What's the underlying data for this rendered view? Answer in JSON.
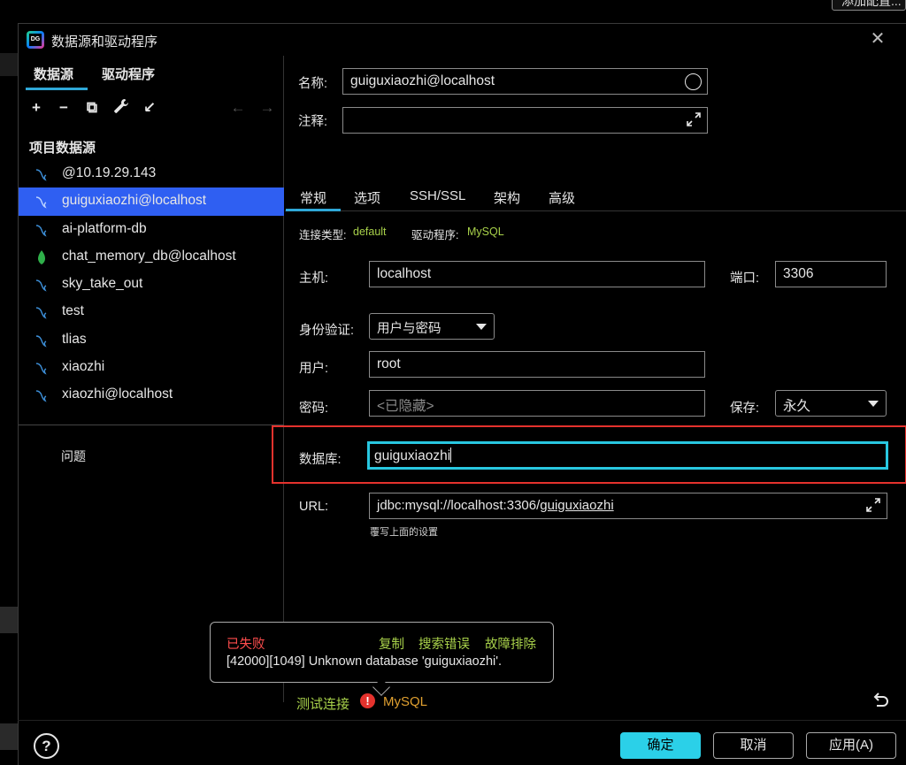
{
  "background": {
    "partial_button": "添加配置..."
  },
  "dialog": {
    "title": "数据源和驱动程序",
    "close_icon": "close-icon"
  },
  "left_panel": {
    "tabs": [
      "数据源",
      "驱动程序"
    ],
    "active_tab": "数据源",
    "toolbar": {
      "add": "+",
      "remove": "−",
      "copy": "⧉",
      "settings": "wrench-icon",
      "import": "↙",
      "back": "←",
      "forward": "→"
    },
    "section_title": "项目数据源",
    "datasources": [
      {
        "label": "@10.19.29.143",
        "icon": "mysql-icon"
      },
      {
        "label": "guiguxiaozhi@localhost",
        "icon": "mysql-icon",
        "selected": true
      },
      {
        "label": "ai-platform-db",
        "icon": "mysql-icon"
      },
      {
        "label": "chat_memory_db@localhost",
        "icon": "mongodb-icon"
      },
      {
        "label": "sky_take_out",
        "icon": "mysql-icon"
      },
      {
        "label": "test",
        "icon": "mysql-icon"
      },
      {
        "label": "tlias",
        "icon": "mysql-icon"
      },
      {
        "label": "xiaozhi",
        "icon": "mysql-icon"
      },
      {
        "label": "xiaozhi@localhost",
        "icon": "mysql-icon"
      }
    ],
    "problems_label": "问题"
  },
  "form": {
    "name_label": "名称:",
    "name_value": "guiguxiaozhi@localhost",
    "comment_label": "注释:",
    "comment_value": "",
    "tabs": [
      "常规",
      "选项",
      "SSH/SSL",
      "架构",
      "高级"
    ],
    "active_tab": "常规",
    "conn_type_label": "连接类型:",
    "conn_type_value": "default",
    "driver_label": "驱动程序:",
    "driver_value": "MySQL",
    "host_label": "主机:",
    "host_value": "localhost",
    "port_label": "端口:",
    "port_value": "3306",
    "auth_label": "身份验证:",
    "auth_value": "用户与密码",
    "user_label": "用户:",
    "user_value": "root",
    "password_label": "密码:",
    "password_placeholder": "<已隐藏>",
    "save_label": "保存:",
    "save_value": "永久",
    "database_label": "数据库:",
    "database_value": "guiguxiaozhi",
    "url_label": "URL:",
    "url_prefix": "jdbc:mysql://localhost:3306/",
    "url_db": "guiguxiaozhi",
    "override_text": "覆写上面的设置"
  },
  "error_popup": {
    "title": "已失败",
    "copy": "复制",
    "search_error": "搜索错误",
    "troubleshoot": "故障排除",
    "message": "[42000][1049] Unknown database 'guiguxiaozhi'."
  },
  "status": {
    "test_connection": "测试连接",
    "error_icon": "!",
    "driver_status": "MySQL"
  },
  "buttons": {
    "help": "?",
    "ok": "确定",
    "cancel": "取消",
    "apply": "应用(A)"
  },
  "colors": {
    "accent": "#2fa8d8",
    "selection": "#2f5ff2",
    "success_link": "#a8d14a",
    "error": "#e5322d",
    "primary_button": "#2bd0e8"
  }
}
